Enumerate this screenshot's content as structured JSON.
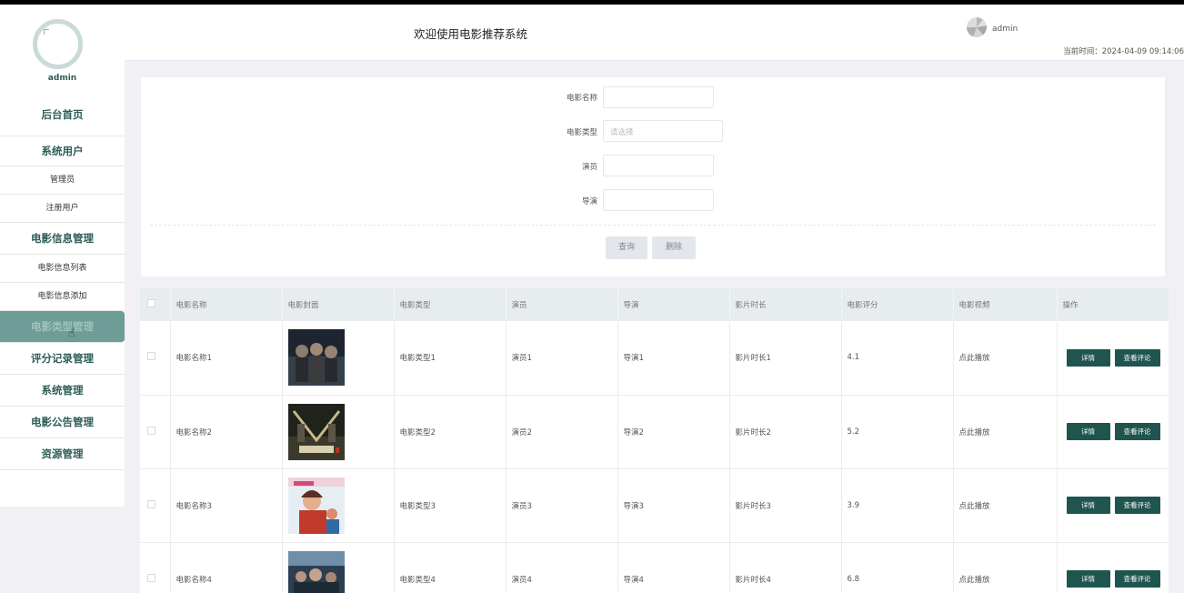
{
  "sidebar": {
    "user": "admin",
    "items": [
      {
        "label": "后台首页",
        "level": "top",
        "active": false
      },
      {
        "label": "系统用户",
        "level": "top",
        "active": false
      },
      {
        "label": "管理员",
        "level": "sub",
        "active": false
      },
      {
        "label": "注册用户",
        "level": "sub",
        "active": false
      },
      {
        "label": "电影信息管理",
        "level": "top",
        "active": false
      },
      {
        "label": "电影信息列表",
        "level": "sub",
        "active": false
      },
      {
        "label": "电影信息添加",
        "level": "sub",
        "active": false
      },
      {
        "label": "电影类型管理",
        "level": "top",
        "active": true
      },
      {
        "label": "评分记录管理",
        "level": "top",
        "active": false
      },
      {
        "label": "系统管理",
        "level": "top",
        "active": false
      },
      {
        "label": "电影公告管理",
        "level": "top",
        "active": false
      },
      {
        "label": "资源管理",
        "level": "top",
        "active": false
      }
    ]
  },
  "header": {
    "title": "欢迎使用电影推荐系统",
    "user": "admin",
    "time": "当前时间：2024-04-09 09:14:06"
  },
  "search": {
    "fields": [
      {
        "label": "电影名称",
        "placeholder": ""
      },
      {
        "label": "电影类型",
        "placeholder": "请选择"
      },
      {
        "label": "演员",
        "placeholder": ""
      },
      {
        "label": "导演",
        "placeholder": ""
      }
    ],
    "query_label": "查询",
    "delete_label": "删除"
  },
  "table": {
    "headers": [
      "电影名称",
      "电影封面",
      "电影类型",
      "演员",
      "导演",
      "影片时长",
      "电影评分",
      "电影视频",
      "操作"
    ],
    "detail_label": "详情",
    "comments_label": "查看评论",
    "rows": [
      {
        "name": "电影名称1",
        "type": "电影类型1",
        "actor": "演员1",
        "director": "导演1",
        "duration": "影片时长1",
        "rating": "4.1",
        "video": "点此播放"
      },
      {
        "name": "电影名称2",
        "type": "电影类型2",
        "actor": "演员2",
        "director": "导演2",
        "duration": "影片时长2",
        "rating": "5.2",
        "video": "点此播放"
      },
      {
        "name": "电影名称3",
        "type": "电影类型3",
        "actor": "演员3",
        "director": "导演3",
        "duration": "影片时长3",
        "rating": "3.9",
        "video": "点此播放"
      },
      {
        "name": "电影名称4",
        "type": "电影类型4",
        "actor": "演员4",
        "director": "导演4",
        "duration": "影片时长4",
        "rating": "6.8",
        "video": "点此播放"
      }
    ]
  },
  "colors": {
    "accent": "#1f554e",
    "sidebar_active": "#6e9c96",
    "sidebar_text": "#2f5e58"
  }
}
